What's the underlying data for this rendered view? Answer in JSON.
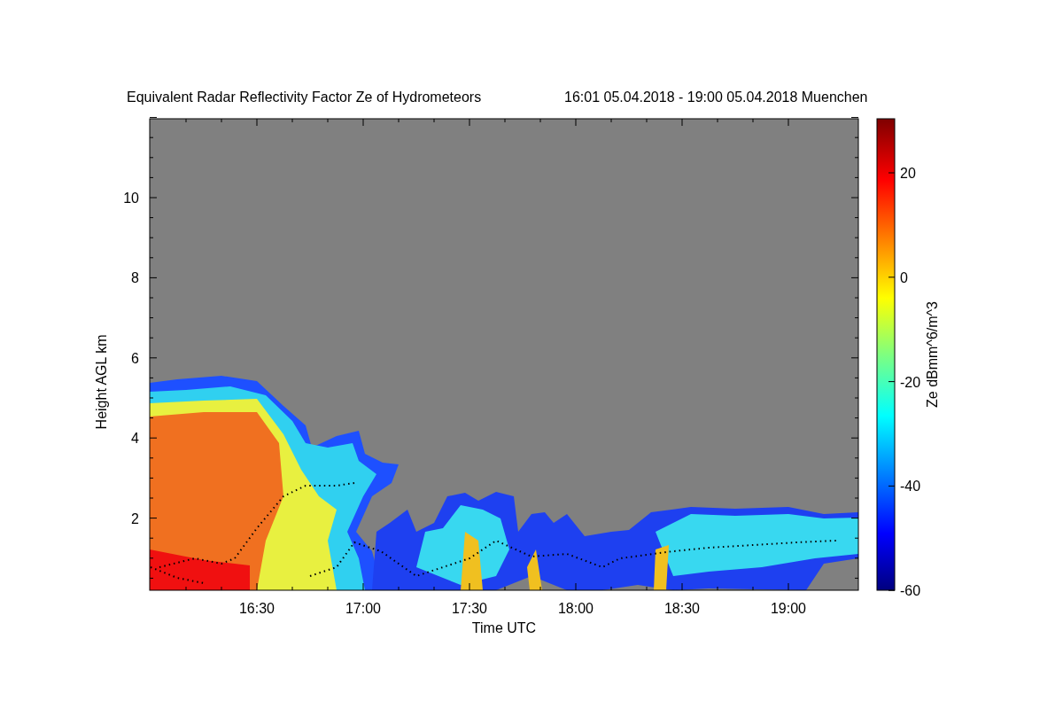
{
  "title": "Equivalent Radar Reflectivity Factor Ze of Hydrometeors",
  "period": "16:01 05.04.2018 - 19:00 05.04.2018 Muenchen",
  "y_axis": {
    "label": "Height AGL km",
    "ticks": [
      "10",
      "8",
      "6",
      "4",
      "2"
    ]
  },
  "x_axis": {
    "label": "Time UTC",
    "ticks": [
      "16:30",
      "17:00",
      "17:30",
      "18:00",
      "18:30",
      "19:00"
    ]
  },
  "colorbar": {
    "label": "Ze dBmm^6/m^3",
    "ticks": [
      "20",
      "0",
      "-20",
      "-40",
      "-60"
    ]
  }
}
